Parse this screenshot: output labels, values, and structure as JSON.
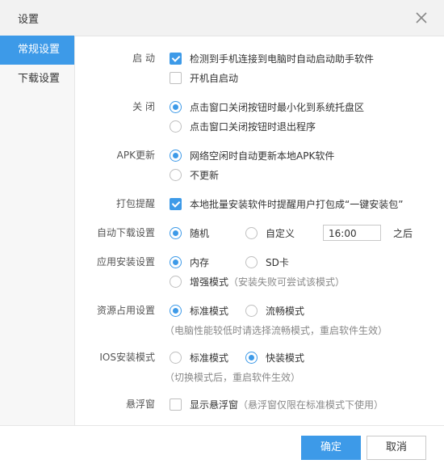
{
  "dialog": {
    "title": "设置"
  },
  "sidebar": {
    "items": [
      {
        "label": "常规设置"
      },
      {
        "label": "下载设置"
      }
    ]
  },
  "startup": {
    "label": "启 动",
    "auto_launch": {
      "label": "检测到手机连接到电脑时自动启动助手软件",
      "checked": true
    },
    "boot": {
      "label": "开机自启动",
      "checked": false
    }
  },
  "close": {
    "label": "关 闭",
    "minimize": {
      "label": "点击窗口关闭按钮时最小化到系统托盘区",
      "selected": true
    },
    "exit": {
      "label": "点击窗口关闭按钮时退出程序",
      "selected": false
    }
  },
  "apk": {
    "label": "APK更新",
    "auto": {
      "label": "网络空闲时自动更新本地APK软件",
      "selected": true
    },
    "never": {
      "label": "不更新",
      "selected": false
    }
  },
  "pack": {
    "label": "打包提醒",
    "remind": {
      "label": "本地批量安装软件时提醒用户打包成“一键安装包”",
      "checked": true
    }
  },
  "auto_download": {
    "label": "自动下载设置",
    "random": {
      "label": "随机",
      "selected": true
    },
    "custom": {
      "label": "自定义",
      "selected": false
    },
    "time_value": "16:00",
    "after": "之后"
  },
  "install": {
    "label": "应用安装设置",
    "internal": {
      "label": "内存",
      "selected": true
    },
    "sd": {
      "label": "SD卡",
      "selected": false
    },
    "enhanced": {
      "label": "增强模式",
      "selected": false
    },
    "enhanced_hint": "（安装失败可尝试该模式）"
  },
  "resource": {
    "label": "资源占用设置",
    "standard": {
      "label": "标准模式",
      "selected": true
    },
    "smooth": {
      "label": "流畅模式",
      "selected": false
    },
    "hint": "（电脑性能较低时请选择流畅模式，重启软件生效）"
  },
  "ios": {
    "label": "IOS安装模式",
    "standard": {
      "label": "标准模式",
      "selected": false
    },
    "fast": {
      "label": "快装模式",
      "selected": true
    },
    "hint": "（切换模式后，重启软件生效）"
  },
  "floating": {
    "label": "悬浮窗",
    "show": {
      "label": "显示悬浮窗",
      "checked": false
    },
    "hint": "（悬浮窗仅限在标准模式下使用）"
  },
  "footer": {
    "ok_label": "确定",
    "cancel_label": "取消"
  },
  "colors": {
    "accent": "#3d9ae8",
    "sidebar_bg": "#f7f7f7",
    "titlebar_bg": "#f2f2f2"
  }
}
